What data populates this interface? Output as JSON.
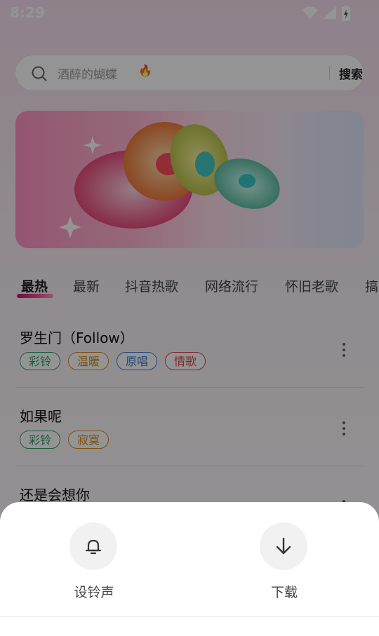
{
  "status_bar": {
    "time": "8:29"
  },
  "search": {
    "placeholder": "酒醉的蝴蝶",
    "fire": "🔥",
    "button": "搜索"
  },
  "tabs": [
    "最热",
    "最新",
    "抖音热歌",
    "网络流行",
    "怀旧老歌",
    "搞"
  ],
  "active_tab": "最热",
  "songs": [
    {
      "title": "罗生门（Follow）",
      "tags": [
        "彩铃",
        "温暖",
        "原唱",
        "情歌"
      ]
    },
    {
      "title": "如果呢",
      "tags": [
        "彩铃",
        "寂寞"
      ]
    },
    {
      "title": "还是会想你",
      "tags": []
    }
  ],
  "sheet": {
    "ringtone_label": "设铃声",
    "download_label": "下载"
  },
  "colors": {
    "tag_green": "#2e9e6a",
    "tag_orange": "#d98a1a",
    "tag_blue": "#3a7fd9",
    "tag_red": "#d8454f",
    "tab_indicator": "#e0287b"
  }
}
